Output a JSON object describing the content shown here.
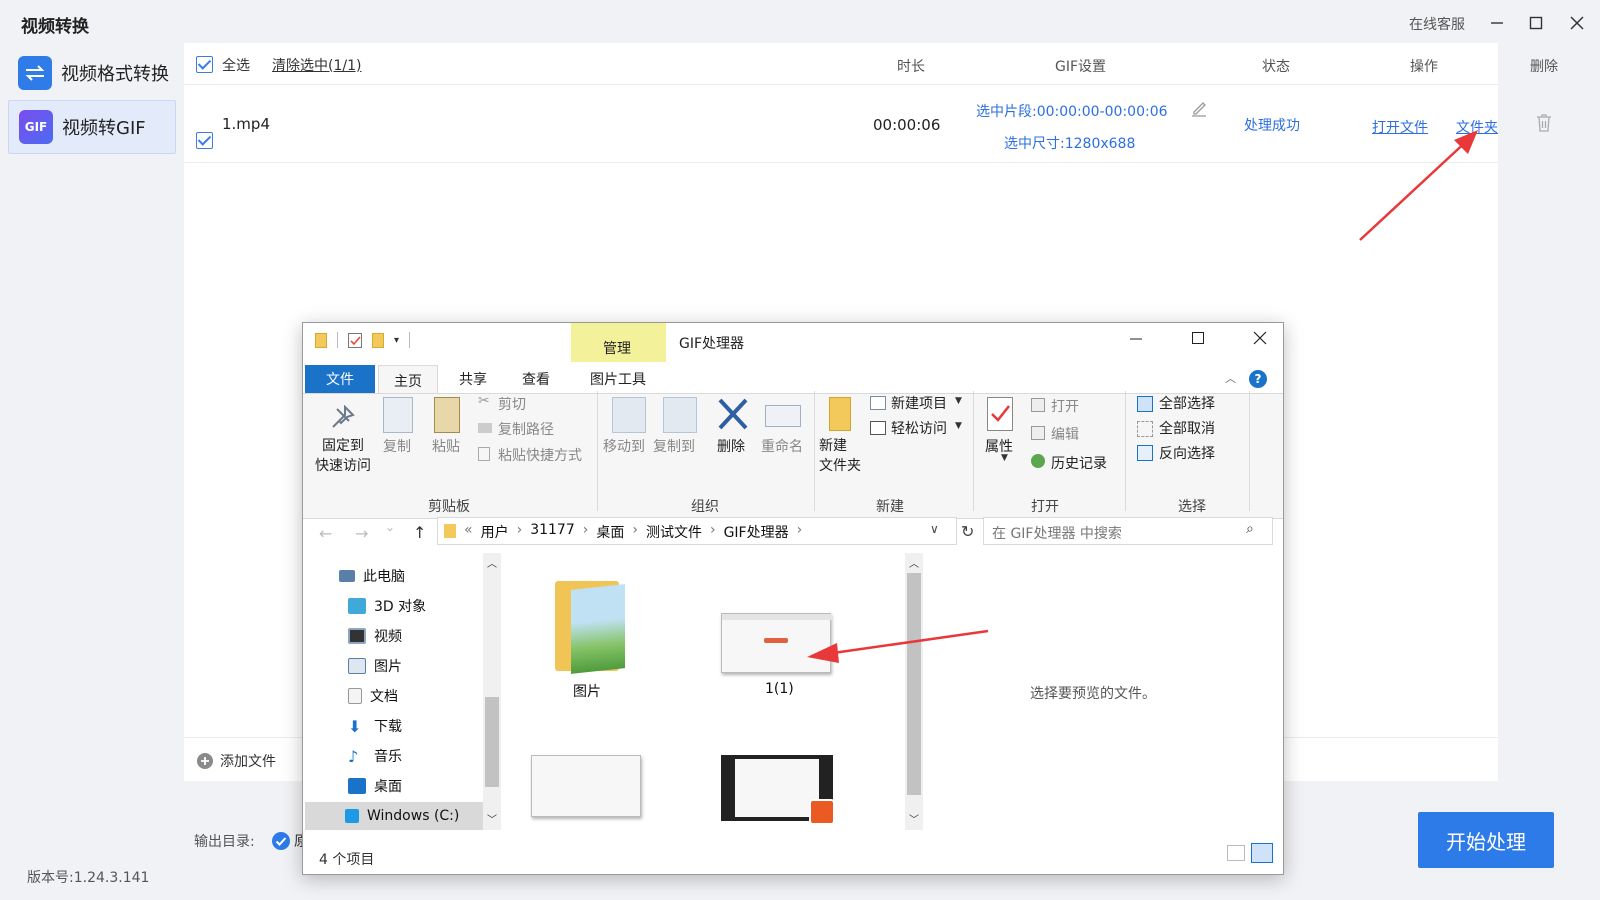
{
  "app": {
    "title": "视频转换",
    "service": "在线客服",
    "version": "版本号:1.24.3.141"
  },
  "sidebar": {
    "items": [
      {
        "label": "视频格式转换",
        "icon": "convert-arrows-icon"
      },
      {
        "label": "视频转GIF",
        "icon": "gif-icon"
      }
    ]
  },
  "table": {
    "select_all": "全选",
    "clear_selected": "清除选中(1/1)",
    "columns": {
      "duration": "时长",
      "gif": "GIF设置",
      "status": "状态",
      "action": "操作",
      "delete": "删除"
    },
    "row": {
      "filename": "1.mp4",
      "duration": "00:00:06",
      "segment": "选中片段:00:00:00-00:00:06",
      "size": "选中尺寸:1280x688",
      "status": "处理成功",
      "open_file": "打开文件",
      "folder": "文件夹"
    }
  },
  "bottom": {
    "add_file": "添加文件",
    "output_dir": "输出目录:",
    "output_dir_value": "原",
    "start": "开始处理"
  },
  "explorer": {
    "title": "GIF处理器",
    "context_tab": "管理",
    "tabs": [
      "文件",
      "主页",
      "共享",
      "查看",
      "图片工具"
    ],
    "ribbon": {
      "pin": "固定到\n快速访问",
      "copy": "复制",
      "paste": "粘贴",
      "cut": "剪切",
      "copy_path": "复制路径",
      "paste_shortcut": "粘贴快捷方式",
      "clipboard": "剪贴板",
      "move_to": "移动到",
      "copy_to": "复制到",
      "delete": "删除",
      "rename": "重命名",
      "organize": "组织",
      "new_folder": "新建\n文件夹",
      "new_item": "新建项目",
      "easy_access": "轻松访问",
      "new": "新建",
      "properties": "属性",
      "open": "打开",
      "edit": "编辑",
      "history": "历史记录",
      "open_group": "打开",
      "select_all": "全部选择",
      "select_none": "全部取消",
      "invert": "反向选择",
      "select_group": "选择"
    },
    "breadcrumb": [
      "用户",
      "31177",
      "桌面",
      "测试文件",
      "GIF处理器"
    ],
    "search_placeholder": "在 GIF处理器 中搜索",
    "nav": [
      "此电脑",
      "3D 对象",
      "视频",
      "图片",
      "文档",
      "下载",
      "音乐",
      "桌面",
      "Windows (C:)"
    ],
    "files": [
      "图片",
      "1(1)"
    ],
    "preview_hint": "选择要预览的文件。",
    "status": "4 个项目"
  }
}
